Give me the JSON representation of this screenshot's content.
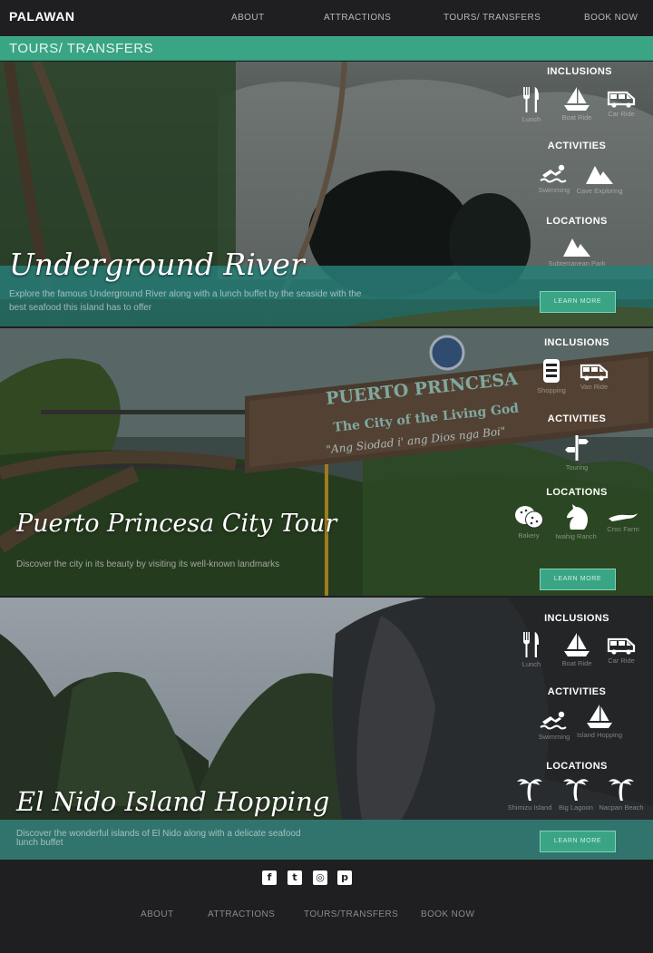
{
  "nav": {
    "brand": "PALAWAN",
    "links": [
      "ABOUT",
      "ATTRACTIONS",
      "TOURS/ TRANSFERS",
      "BOOK NOW"
    ]
  },
  "page_heading": "TOURS/ TRANSFERS",
  "sections": {
    "inclusions": "INCLUSIONS",
    "activities": "ACTIVITIES",
    "locations": "LOCATIONS"
  },
  "learn_more": "LEARN MORE",
  "tours": [
    {
      "title": "Underground River",
      "description": "Explore the famous Underground River along with a lunch buffet by the seaside with the best seafood this island has to offer",
      "inclusions": [
        {
          "icon": "utensils-icon",
          "label": "Lunch"
        },
        {
          "icon": "sailboat-icon",
          "label": "Boat Ride"
        },
        {
          "icon": "van-icon",
          "label": "Car Ride"
        }
      ],
      "activities": [
        {
          "icon": "swimming-icon",
          "label": "Swimming"
        },
        {
          "icon": "mountain-icon",
          "label": "Cave Exploring"
        }
      ],
      "locations": [
        {
          "icon": "mountain-icon",
          "label": "Subterranean Park"
        }
      ]
    },
    {
      "title": "Puerto Princesa City Tour",
      "description": "Discover the city in its beauty by visiting its well-known landmarks",
      "inclusions": [
        {
          "icon": "food-icon",
          "label": "Shopping"
        },
        {
          "icon": "van-icon",
          "label": "Van Ride"
        }
      ],
      "activities": [
        {
          "icon": "signpost-icon",
          "label": "Touring"
        }
      ],
      "locations": [
        {
          "icon": "cookie-icon",
          "label": "Bakery"
        },
        {
          "icon": "horse-icon",
          "label": "Iwahig Ranch"
        },
        {
          "icon": "crocodile-icon",
          "label": "Croc Farm"
        }
      ]
    },
    {
      "title": "El Nido Island Hopping",
      "description": "Discover the wonderful islands of El Nido along with a delicate seafood lunch buffet",
      "inclusions": [
        {
          "icon": "utensils-icon",
          "label": "Lunch"
        },
        {
          "icon": "sailboat-icon",
          "label": "Boat Ride"
        },
        {
          "icon": "van-icon",
          "label": "Car Ride"
        }
      ],
      "activities": [
        {
          "icon": "swimming-icon",
          "label": "Swimming"
        },
        {
          "icon": "sailboat-icon",
          "label": "Island Hopping"
        }
      ],
      "locations": [
        {
          "icon": "palm-tree-icon",
          "label": "Shimizu Island"
        },
        {
          "icon": "palm-tree-icon",
          "label": "Big Lagoon"
        },
        {
          "icon": "palm-tree-icon",
          "label": "Nacpan Beach"
        }
      ]
    }
  ],
  "footer": {
    "social": [
      {
        "icon": "facebook-icon",
        "glyph": "f"
      },
      {
        "icon": "twitter-icon",
        "glyph": "t"
      },
      {
        "icon": "instagram-icon",
        "glyph": "◎"
      },
      {
        "icon": "pinterest-icon",
        "glyph": "p"
      }
    ],
    "links": [
      "ABOUT",
      "ATTRACTIONS",
      "TOURS/TRANSFERS",
      "BOOK NOW"
    ]
  },
  "colors": {
    "accent": "#3aa585",
    "dark": "#1f1f21"
  }
}
